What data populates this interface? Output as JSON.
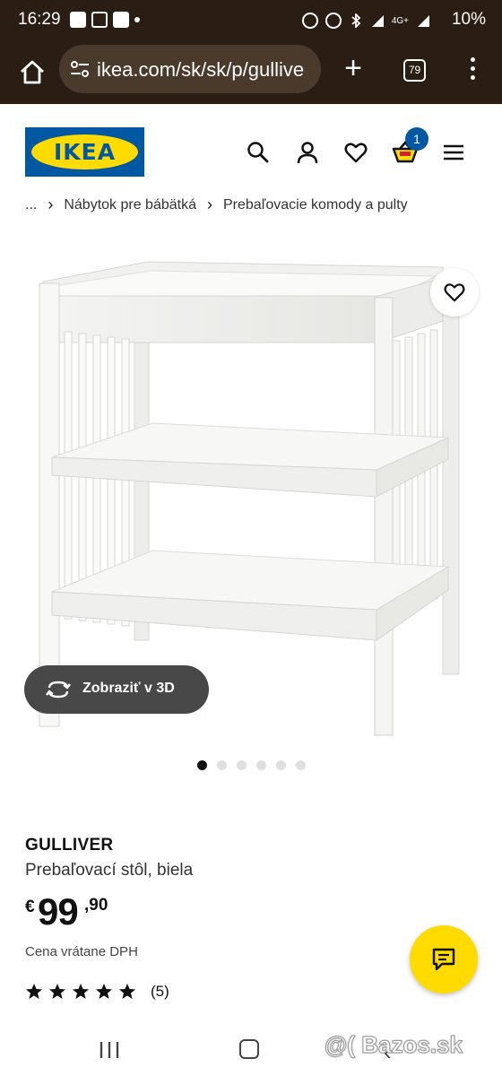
{
  "status_bar": {
    "time": "16:29",
    "network": "4G+",
    "battery": "10%"
  },
  "browser": {
    "url": "ikea.com/sk/sk/p/gullive",
    "tab_count": "79",
    "icons": [
      "home-icon",
      "site-settings-icon",
      "new-tab-icon",
      "tabs-icon",
      "more-icon"
    ]
  },
  "header": {
    "logo_text": "IKEA",
    "cart_count": "1",
    "icons": [
      "search-icon",
      "user-icon",
      "heart-icon",
      "cart-icon",
      "hamburger-icon"
    ],
    "brand_colors": {
      "blue": "#0058a3",
      "yellow": "#ffdb00"
    }
  },
  "breadcrumb": {
    "items": [
      "...",
      "Nábytok pre bábätká",
      "Prebaľovacie komody a pulty"
    ],
    "separator": "›"
  },
  "product": {
    "view_3d_label": "Zobraziť v 3D",
    "image_count": 6,
    "active_image": 1,
    "name": "GULLIVER",
    "description": "Prebaľovací stôl, biela",
    "price": {
      "currency": "€",
      "integer": "99",
      "decimal": ",90"
    },
    "price_note": "Cena vrátane DPH",
    "rating_stars": 5,
    "review_count": "(5)"
  },
  "watermark": "@( Bazos.sk"
}
